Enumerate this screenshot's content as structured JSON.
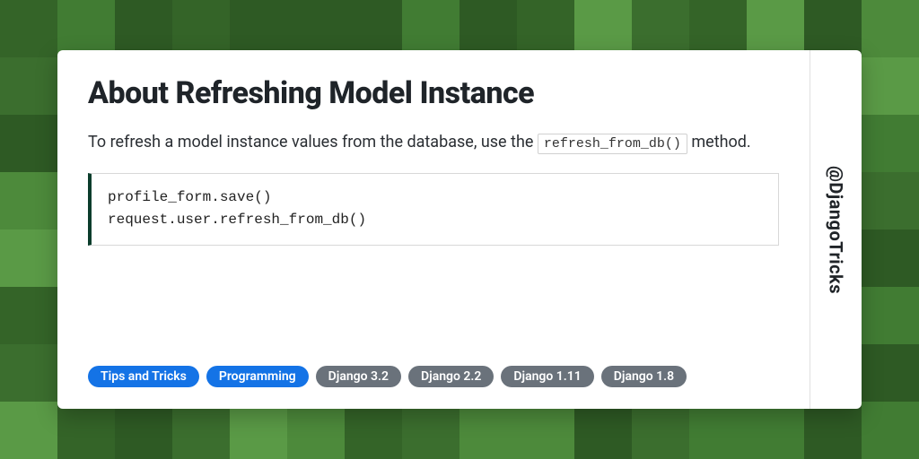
{
  "title": "About Refreshing Model Instance",
  "description_pre": "To refresh a model instance values from the database, use the ",
  "description_code": "refresh_from_db()",
  "description_post": " method.",
  "code": "profile_form.save()\nrequest.user.refresh_from_db()",
  "tags": [
    {
      "label": "Tips and Tricks",
      "variant": "blue"
    },
    {
      "label": "Programming",
      "variant": "blue"
    },
    {
      "label": "Django 3.2",
      "variant": "gray"
    },
    {
      "label": "Django 2.2",
      "variant": "gray"
    },
    {
      "label": "Django 1.11",
      "variant": "gray"
    },
    {
      "label": "Django 1.8",
      "variant": "gray"
    }
  ],
  "handle": "@DjangoTricks",
  "bg_colors": [
    "#3b6e2e",
    "#4d8a3b",
    "#2e5a24",
    "#5a9a46",
    "#417c33",
    "#346428"
  ]
}
